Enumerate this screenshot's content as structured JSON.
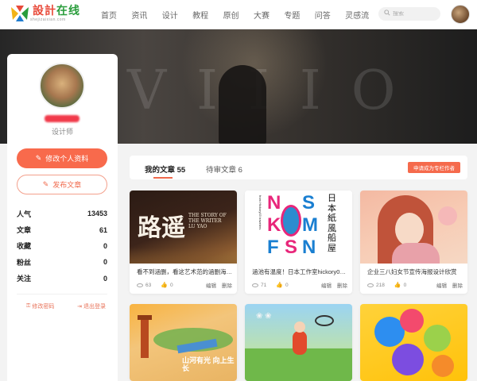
{
  "brand": {
    "logo_text_a": "設計",
    "logo_text_b": "在线",
    "logo_sub": "shejizaixian.com",
    "colors": {
      "accent": "#f06a4c",
      "green": "#2a9d3c"
    }
  },
  "nav": [
    "首页",
    "资讯",
    "设计",
    "教程",
    "原创",
    "大赛",
    "专题",
    "问答",
    "灵感流"
  ],
  "search": {
    "placeholder": "搜索"
  },
  "profile": {
    "role": "设计师",
    "edit_label": "修改个人资料",
    "publish_label": "发布文章",
    "stats": [
      {
        "label": "人气",
        "value": "13453"
      },
      {
        "label": "文章",
        "value": "61"
      },
      {
        "label": "收藏",
        "value": "0"
      },
      {
        "label": "粉丝",
        "value": "0"
      },
      {
        "label": "关注",
        "value": "0"
      }
    ],
    "change_password": "修改密码",
    "logout": "退出登录"
  },
  "tabs": {
    "mine": "我的文章 55",
    "pending": "待审文章 6",
    "apply": "申请成为专栏作者"
  },
  "cards": [
    {
      "title": "看不到涵删，看这艺术范的涵删海报设计...",
      "views": "63",
      "likes": "0",
      "edit": "编辑",
      "delete": "删除"
    },
    {
      "title": "涵池有温度！日本工作室hickory03tra...",
      "views": "71",
      "likes": "0",
      "edit": "编辑",
      "delete": "删除"
    },
    {
      "title": "企业三八妇女节宣传海报设计欣赏",
      "views": "218",
      "likes": "0",
      "edit": "编辑",
      "delete": "删除"
    },
    {
      "title": "",
      "views": "",
      "likes": "",
      "edit": "",
      "delete": ""
    },
    {
      "title": "",
      "views": "",
      "likes": "",
      "edit": "",
      "delete": ""
    },
    {
      "title": "",
      "views": "",
      "likes": "",
      "edit": "",
      "delete": ""
    }
  ],
  "thumb_text": {
    "c1_main": "路遥",
    "c1_en": "THE STORY OF THE WRITER LU YAO",
    "c2_letters": [
      "N",
      "S",
      "K",
      "M",
      "F",
      "S",
      "N"
    ],
    "c2_jp": "日本紙風船屋",
    "c4_text": "山河有光 向上生长"
  },
  "icons": {
    "search": "search-icon",
    "edit": "pencil-icon",
    "eye": "eye-icon",
    "like": "thumbs-up-icon"
  }
}
